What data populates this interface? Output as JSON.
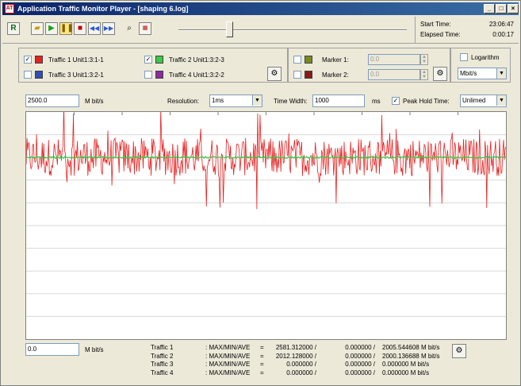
{
  "window": {
    "title": "Application Traffic Monitor Player - [shaping 6.log]",
    "buttons": [
      "_",
      "□",
      "×"
    ]
  },
  "toolbar": {
    "icons": [
      "report-icon",
      "open-folder-icon",
      "play-icon",
      "pause-icon",
      "stop-icon",
      "rewind-icon",
      "fast-forward-icon",
      "find-icon",
      "auto-icon"
    ],
    "slider_position": 0.22
  },
  "time": {
    "start_label": "Start Time:",
    "start_value": "23:06:47",
    "elapsed_label": "Elapsed Time:",
    "elapsed_value": "0:00:17"
  },
  "traffic": [
    {
      "label": "Traffic 1 Unit1:3:1-1",
      "checked": true,
      "color": "#e82020"
    },
    {
      "label": "Traffic 2 Unit1:3:2-3",
      "checked": true,
      "color": "#3cc84a"
    },
    {
      "label": "Traffic 3 Unit1:3:2-1",
      "checked": false,
      "color": "#2f4fb4"
    },
    {
      "label": "Traffic 4 Unit1:3:2-2",
      "checked": false,
      "color": "#8a2aa0"
    }
  ],
  "markers": {
    "marker1_label": "Marker 1:",
    "marker1_value": "0.0",
    "marker1_color": "#7a8a20",
    "marker2_label": "Marker 2:",
    "marker2_value": "0.0",
    "marker2_color": "#8a1a1a"
  },
  "options": {
    "logarithm_label": "Logarithm",
    "unit_select": "Mbit/s"
  },
  "controls": {
    "ymax_value": "2500.0",
    "ymax_unit": "M bit/s",
    "resolution_label": "Resolution:",
    "resolution_value": "1ms",
    "time_width_label": "Time Width:",
    "time_width_value": "1000",
    "time_width_unit": "ms",
    "peak_hold_label": "Peak Hold Time:",
    "peak_hold_value": "Unlimed",
    "ymin_value": "0.0",
    "ymin_unit": "M bit/s"
  },
  "stats": {
    "rows": [
      {
        "name": "Traffic 1",
        "label": ": MAX/MIN/AVE",
        "eq": "=",
        "max": "2581.312000 /",
        "min": "0.000000 /",
        "ave": "2005.544608 M bit/s"
      },
      {
        "name": "Traffic 2",
        "label": ": MAX/MIN/AVE",
        "eq": "=",
        "max": "2012.128000 /",
        "min": "0.000000 /",
        "ave": "2000.136688 M bit/s"
      },
      {
        "name": "Traffic 3",
        "label": ": MAX/MIN/AVE",
        "eq": "=",
        "max": "0.000000 /",
        "min": "0.000000 /",
        "ave": "0.000000 M bit/s"
      },
      {
        "name": "Traffic 4",
        "label": ": MAX/MIN/AVE",
        "eq": "=",
        "max": "0.000000 /",
        "min": "0.000000 /",
        "ave": "0.000000 M bit/s"
      }
    ]
  },
  "chart_data": {
    "type": "line",
    "ylim": [
      0,
      2500
    ],
    "xlim": [
      0,
      1000
    ],
    "grid": true,
    "series": [
      {
        "name": "Traffic 1 Unit1:3:1-1",
        "color": "#e82020",
        "approx_mean": 2005.5,
        "max": 2581.3,
        "min": 0
      },
      {
        "name": "Traffic 2 Unit1:3:2-3",
        "color": "#3cc84a",
        "approx_mean": 2000.1,
        "max": 2012.1,
        "min": 0
      }
    ]
  }
}
